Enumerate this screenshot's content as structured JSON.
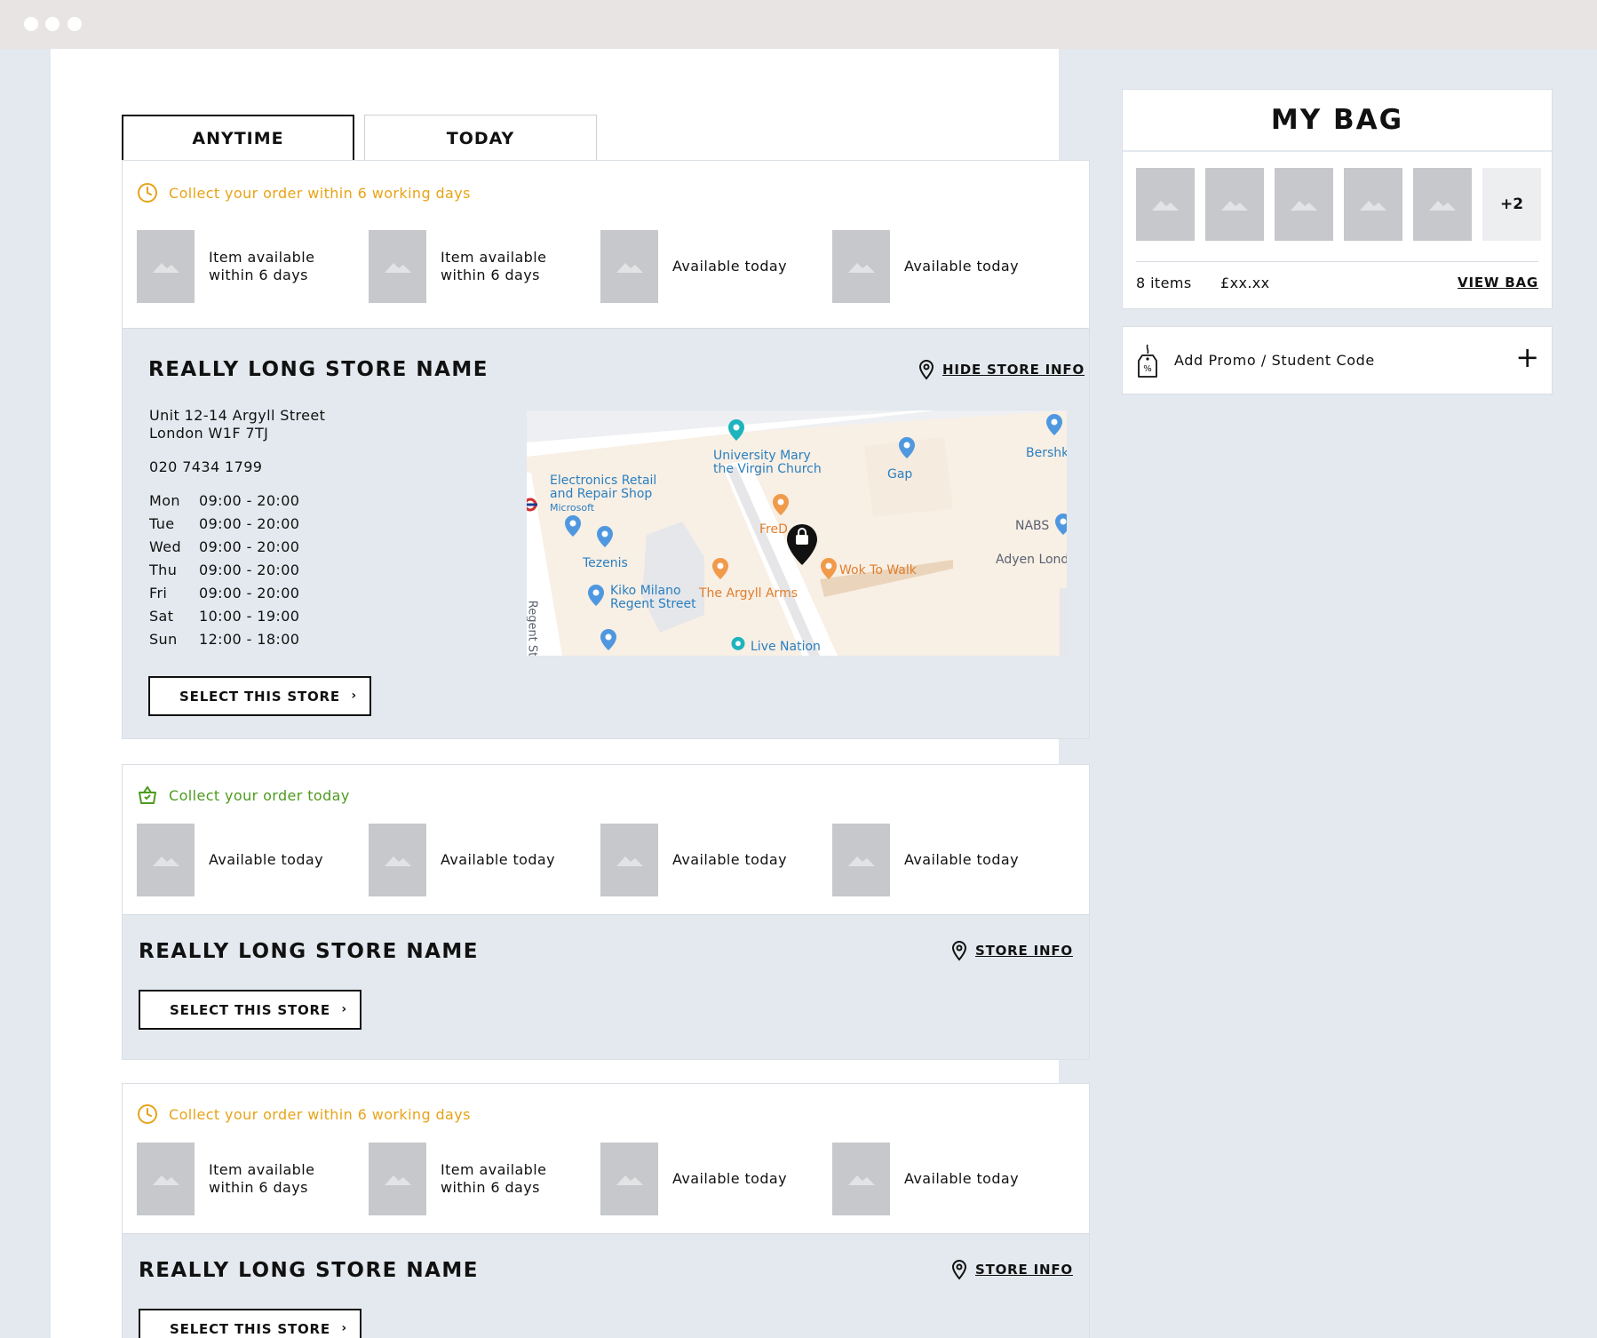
{
  "tabs": {
    "anytime": "ANYTIME",
    "today": "TODAY"
  },
  "colors": {
    "orange": "#e8a317",
    "green": "#4e9a1e",
    "panel": "#e3e9ee",
    "placeholder": "#c6c8cb"
  },
  "cards": [
    {
      "status": "Collect your order within 6 working days",
      "status_icon": "clock-icon",
      "items": [
        "Item available within 6 days",
        "Item available within 6 days",
        "Available today",
        "Available today"
      ],
      "store_name": "REALLY LONG STORE NAME",
      "store_link": "HIDE STORE INFO",
      "address_line1": "Unit 12-14 Argyll Street",
      "address_line2": "London W1F 7TJ",
      "phone": "020 7434 1799",
      "hours": [
        {
          "day": "Mon",
          "time": "09:00 - 20:00"
        },
        {
          "day": "Tue",
          "time": "09:00 - 20:00"
        },
        {
          "day": "Wed",
          "time": "09:00 - 20:00"
        },
        {
          "day": "Thu",
          "time": "09:00 - 20:00"
        },
        {
          "day": "Fri",
          "time": "09:00 - 20:00"
        },
        {
          "day": "Sat",
          "time": "10:00 - 19:00"
        },
        {
          "day": "Sun",
          "time": "12:00 - 18:00"
        }
      ],
      "select_label": "SELECT THIS STORE"
    },
    {
      "status": "Collect your order today",
      "status_icon": "basket-icon",
      "items": [
        "Available today",
        "Available today",
        "Available today",
        "Available today"
      ],
      "store_name": "REALLY LONG STORE NAME",
      "store_link": "STORE INFO",
      "select_label": "SELECT THIS STORE"
    },
    {
      "status": "Collect your order within 6 working days",
      "status_icon": "clock-icon",
      "items": [
        "Item available within 6 days",
        "Item available within 6 days",
        "Available today",
        "Available today"
      ],
      "store_name": "REALLY LONG STORE NAME",
      "store_link": "STORE INFO",
      "select_label": "SELECT THIS STORE"
    }
  ],
  "map": {
    "labels": {
      "church": "University Mary the Virgin Church",
      "church_line1": "University Mary",
      "church_line2": "the Virgin Church",
      "electronics_line1": "Electronics Retail",
      "electronics_line2": "and Repair Shop",
      "microsoft": "Microsoft",
      "gap": "Gap",
      "bershka": "Bershk",
      "nabs": "NABS",
      "adyen": "Adyen Lond",
      "tezenis": "Tezenis",
      "fred": "FreD",
      "wok": "Wok To Walk",
      "kiko_line1": "Kiko Milano",
      "kiko_line2": "Regent Street",
      "argyll_arms": "The Argyll Arms",
      "live_nation": "Live Nation",
      "regent_st": "Regent St"
    }
  },
  "bag": {
    "title": "MY BAG",
    "more": "+2",
    "count": "8 items",
    "price": "£xx.xx",
    "view": "VIEW BAG"
  },
  "promo": {
    "label": "Add Promo / Student Code",
    "plus": "+"
  }
}
